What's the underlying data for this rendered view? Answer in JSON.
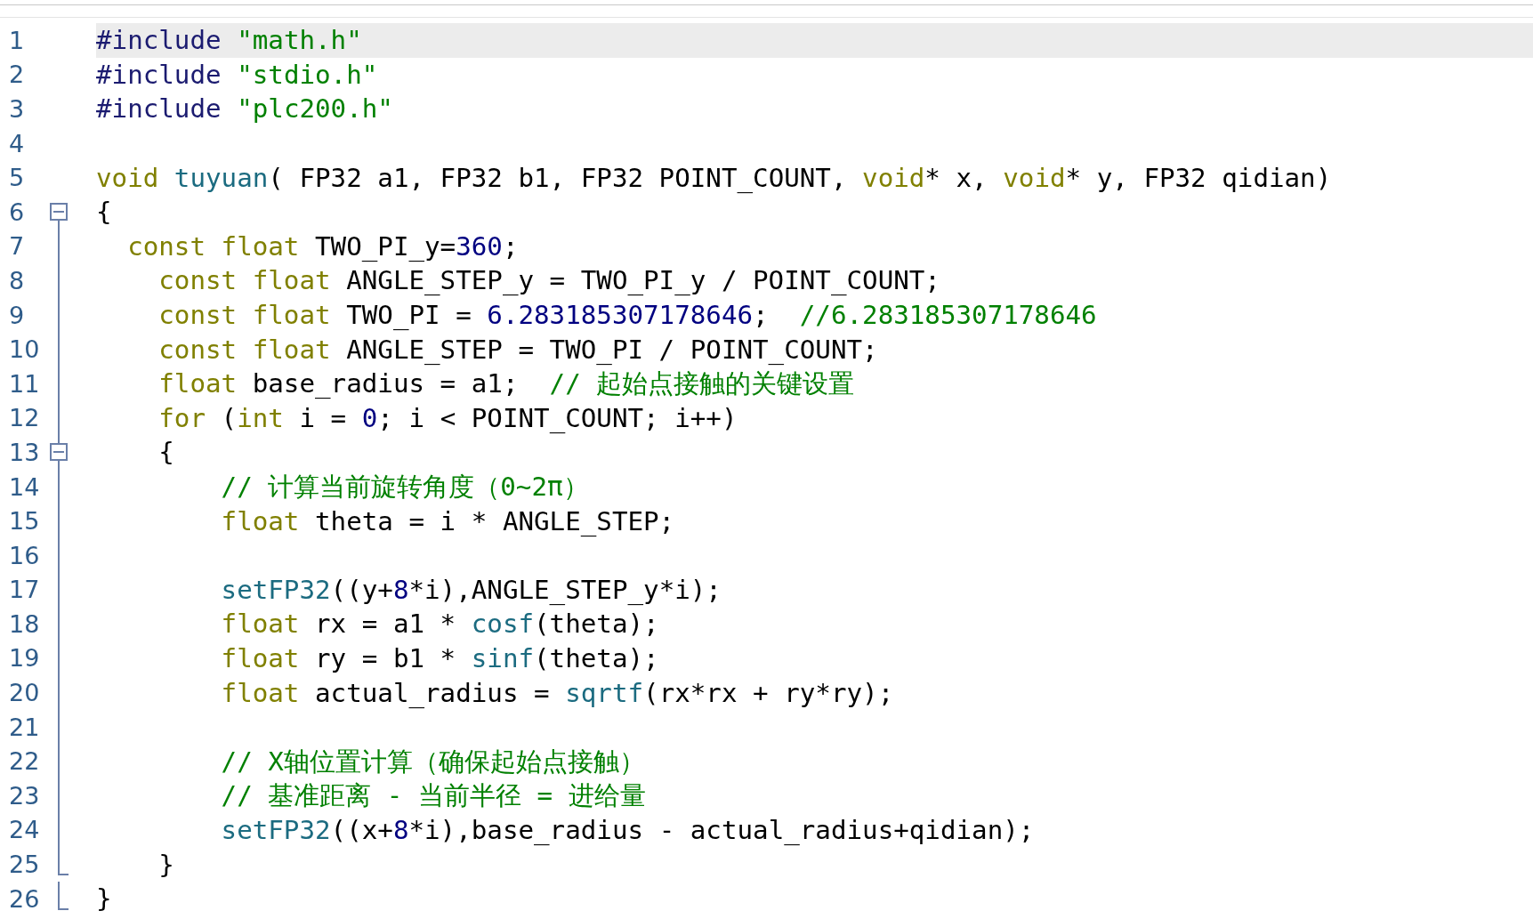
{
  "editor": {
    "lines": [
      {
        "number": "1",
        "kind": "plain",
        "current": true,
        "tokens": [
          {
            "kind": "pp",
            "text": "#include"
          },
          {
            "kind": "str",
            "text": " \"math.h\""
          }
        ]
      },
      {
        "number": "2",
        "kind": "plain",
        "current": false,
        "tokens": [
          {
            "kind": "pp",
            "text": "#include"
          },
          {
            "kind": "str",
            "text": " \"stdio.h\""
          }
        ]
      },
      {
        "number": "3",
        "kind": "plain",
        "current": false,
        "tokens": [
          {
            "kind": "pp",
            "text": "#include"
          },
          {
            "kind": "str",
            "text": " \"plc200.h\""
          }
        ]
      },
      {
        "number": "4",
        "kind": "plain",
        "current": false
      },
      {
        "number": "5",
        "kind": "plain",
        "current": false,
        "tokens": [
          {
            "kind": "kw",
            "text": "void"
          },
          {
            "kind": "fn",
            "text": " tuyuan"
          },
          {
            "kind": "plain",
            "text": "( FP32 a1, FP32 b1, FP32 POINT_COUNT, "
          },
          {
            "kind": "kw",
            "text": "void"
          },
          {
            "kind": "plain",
            "text": "* x, "
          },
          {
            "kind": "kw",
            "text": "void"
          },
          {
            "kind": "plain",
            "text": "* y, FP32 qidian)"
          }
        ]
      },
      {
        "number": "6",
        "kind": "open",
        "current": false,
        "tokens": [
          {
            "kind": "plain",
            "text": "{"
          }
        ]
      },
      {
        "number": "7",
        "kind": "inner",
        "current": false,
        "tokens": [
          {
            "kind": "kw",
            "text": "  const float"
          },
          {
            "kind": "plain",
            "text": " TWO_PI_y="
          },
          {
            "kind": "num",
            "text": "360"
          },
          {
            "kind": "plain",
            "text": ";"
          }
        ]
      },
      {
        "number": "8",
        "kind": "inner",
        "current": false,
        "tokens": [
          {
            "kind": "kw",
            "text": "    const float"
          },
          {
            "kind": "plain",
            "text": " ANGLE_STEP_y = TWO_PI_y / POINT_COUNT;"
          }
        ]
      },
      {
        "number": "9",
        "kind": "inner",
        "current": false,
        "tokens": [
          {
            "kind": "kw",
            "text": "    const float"
          },
          {
            "kind": "plain",
            "text": " TWO_PI = "
          },
          {
            "kind": "num",
            "text": "6.283185307178646"
          },
          {
            "kind": "plain",
            "text": ";"
          },
          {
            "kind": "cm",
            "text": "  //6.283185307178646"
          }
        ]
      },
      {
        "number": "10",
        "kind": "inner",
        "current": false,
        "tokens": [
          {
            "kind": "kw",
            "text": "    const float"
          },
          {
            "kind": "plain",
            "text": " ANGLE_STEP = TWO_PI / POINT_COUNT;"
          }
        ]
      },
      {
        "number": "11",
        "kind": "inner",
        "current": false,
        "tokens": [
          {
            "kind": "kw",
            "text": "    float"
          },
          {
            "kind": "plain",
            "text": " base_radius = a1;"
          },
          {
            "kind": "cm",
            "text": "  // 起始点接触的关键设置"
          }
        ]
      },
      {
        "number": "12",
        "kind": "inner",
        "current": false,
        "tokens": [
          {
            "kind": "kw",
            "text": "    for"
          },
          {
            "kind": "plain",
            "text": " ("
          },
          {
            "kind": "kw",
            "text": "int"
          },
          {
            "kind": "plain",
            "text": " i = "
          },
          {
            "kind": "num",
            "text": "0"
          },
          {
            "kind": "plain",
            "text": "; i < POINT_COUNT; i++)"
          }
        ]
      },
      {
        "number": "13",
        "kind": "open",
        "current": false,
        "tokens": [
          {
            "kind": "plain",
            "text": "    {"
          }
        ]
      },
      {
        "number": "14",
        "kind": "inner",
        "current": false,
        "tokens": [
          {
            "kind": "cm",
            "text": "        // 计算当前旋转角度（0~2π）"
          }
        ]
      },
      {
        "number": "15",
        "kind": "inner",
        "current": false,
        "tokens": [
          {
            "kind": "kw",
            "text": "        float"
          },
          {
            "kind": "plain",
            "text": " theta = i * ANGLE_STEP;"
          }
        ]
      },
      {
        "number": "16",
        "kind": "inner",
        "current": false
      },
      {
        "number": "17",
        "kind": "inner",
        "current": false,
        "tokens": [
          {
            "kind": "fn",
            "text": "        setFP32"
          },
          {
            "kind": "plain",
            "text": "((y+"
          },
          {
            "kind": "num",
            "text": "8"
          },
          {
            "kind": "plain",
            "text": "*i),ANGLE_STEP_y*i);"
          }
        ]
      },
      {
        "number": "18",
        "kind": "inner",
        "current": false,
        "tokens": [
          {
            "kind": "kw",
            "text": "        float"
          },
          {
            "kind": "plain",
            "text": " rx = a1 * "
          },
          {
            "kind": "fn",
            "text": "cosf"
          },
          {
            "kind": "plain",
            "text": "(theta);"
          }
        ]
      },
      {
        "number": "19",
        "kind": "inner",
        "current": false,
        "tokens": [
          {
            "kind": "kw",
            "text": "        float"
          },
          {
            "kind": "plain",
            "text": " ry = b1 * "
          },
          {
            "kind": "fn",
            "text": "sinf"
          },
          {
            "kind": "plain",
            "text": "(theta);"
          }
        ]
      },
      {
        "number": "20",
        "kind": "inner",
        "current": false,
        "tokens": [
          {
            "kind": "kw",
            "text": "        float"
          },
          {
            "kind": "plain",
            "text": " actual_radius = "
          },
          {
            "kind": "fn",
            "text": "sqrtf"
          },
          {
            "kind": "plain",
            "text": "(rx*rx + ry*ry);"
          }
        ]
      },
      {
        "number": "21",
        "kind": "inner",
        "current": false
      },
      {
        "number": "22",
        "kind": "inner",
        "current": false,
        "tokens": [
          {
            "kind": "cm",
            "text": "        // X轴位置计算（确保起始点接触）"
          }
        ]
      },
      {
        "number": "23",
        "kind": "inner",
        "current": false,
        "tokens": [
          {
            "kind": "cm",
            "text": "        // 基准距离 - 当前半径 = 进给量"
          }
        ]
      },
      {
        "number": "24",
        "kind": "inner",
        "current": false,
        "tokens": [
          {
            "kind": "fn",
            "text": "        setFP32"
          },
          {
            "kind": "plain",
            "text": "((x+"
          },
          {
            "kind": "num",
            "text": "8"
          },
          {
            "kind": "plain",
            "text": "*i),base_radius - actual_radius+qidian);"
          }
        ]
      },
      {
        "number": "25",
        "kind": "close",
        "current": false,
        "tokens": [
          {
            "kind": "plain",
            "text": "    }"
          }
        ]
      },
      {
        "number": "26",
        "kind": "close",
        "current": false,
        "tokens": [
          {
            "kind": "plain",
            "text": "}"
          }
        ]
      }
    ]
  }
}
